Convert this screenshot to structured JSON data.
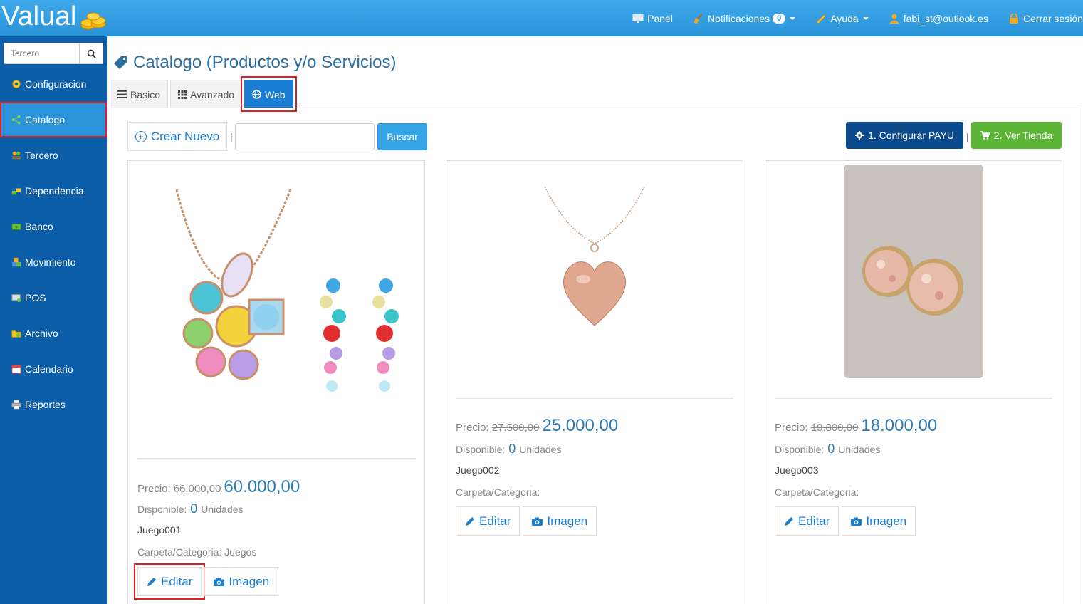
{
  "app": {
    "logo_text": "Valual"
  },
  "topnav": {
    "panel": "Panel",
    "notificaciones": "Notificaciones",
    "notif_count": "0",
    "ayuda": "Ayuda",
    "user": "fabi_st@outlook.es",
    "logout": "Cerrar sesión"
  },
  "sidebar": {
    "search_placeholder": "Tercero",
    "items": [
      {
        "label": "Configuracion",
        "icon": "gear-icon"
      },
      {
        "label": "Catalogo",
        "icon": "catalog-icon"
      },
      {
        "label": "Tercero",
        "icon": "users-icon"
      },
      {
        "label": "Dependencia",
        "icon": "dependency-icon"
      },
      {
        "label": "Banco",
        "icon": "bank-icon"
      },
      {
        "label": "Movimiento",
        "icon": "movement-icon"
      },
      {
        "label": "POS",
        "icon": "pos-icon"
      },
      {
        "label": "Archivo",
        "icon": "archive-icon"
      },
      {
        "label": "Calendario",
        "icon": "calendar-icon"
      },
      {
        "label": "Reportes",
        "icon": "printer-icon"
      }
    ]
  },
  "main": {
    "title": "Catalogo (Productos y/o Servicios)",
    "tabs": [
      "Basico",
      "Avanzado",
      "Web"
    ],
    "new_button": "Crear Nuevo",
    "separator": "|",
    "search_value": "",
    "search_button": "Buscar",
    "payu_button": "1. Configurar PAYU",
    "store_button": "2. Ver Tienda"
  },
  "labels": {
    "price": "Precio:",
    "available": "Disponible:",
    "units": "Unidades",
    "category": "Carpeta/Categoria:",
    "edit": "Editar",
    "image": "Imagen"
  },
  "products": [
    {
      "old_price": "66.000,00",
      "price": "60.000,00",
      "stock": "0",
      "code": "Juego001",
      "category": "Juegos",
      "image": "jewelry-set-image"
    },
    {
      "old_price": "27.500,00",
      "price": "25.000,00",
      "stock": "0",
      "code": "Juego002",
      "category": "",
      "image": "heart-necklace-image"
    },
    {
      "old_price": "19.800,00",
      "price": "18.000,00",
      "stock": "0",
      "code": "Juego003",
      "category": "",
      "image": "stud-earrings-image"
    }
  ],
  "colors": {
    "topbar": "#2a93d9",
    "sidebar": "#0d5ea8",
    "accent": "#1a7fd4",
    "payu": "#0b4a8c",
    "store": "#5cb536",
    "highlight": "#e02020"
  }
}
